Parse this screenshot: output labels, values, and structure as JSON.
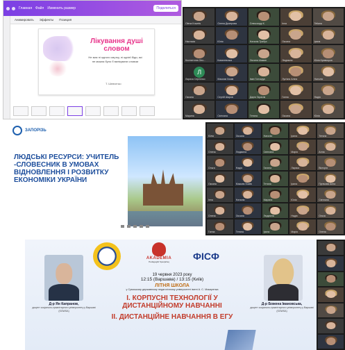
{
  "canva": {
    "menu": [
      "Главная",
      "Файл",
      "Изменить размер"
    ],
    "share": "Поделиться",
    "toolbar": [
      "Анимировать",
      "Эффекты",
      "Позиция"
    ],
    "slide_title": "Лікування душі словом",
    "slide_body": "Не має ні одного смутку, ні однієї біди, які не можна було б вилікувати словом",
    "slide_sign": "Т. Шевченко"
  },
  "grid1": [
    {
      "name": "Olena Kravets",
      "letter": ""
    },
    {
      "name": "Олена Дмитрова",
      "letter": ""
    },
    {
      "name": "Олександр К.",
      "letter": ""
    },
    {
      "name": "Inna",
      "letter": ""
    },
    {
      "name": "Tetiana",
      "letter": ""
    },
    {
      "name": "Настасія",
      "letter": ""
    },
    {
      "name": "Юлія",
      "letter": ""
    },
    {
      "name": "Наталія Трибух",
      "letter": ""
    },
    {
      "name": "Оксана",
      "letter": ""
    },
    {
      "name": "Ірина",
      "letter": ""
    },
    {
      "name": "Костянтина Оно...",
      "letter": ""
    },
    {
      "name": "Ковалевська",
      "letter": ""
    },
    {
      "name": "Оксана Шаман",
      "letter": ""
    },
    {
      "name": "Людмила",
      "letter": ""
    },
    {
      "name": "Юлія Кривоцька",
      "letter": ""
    },
    {
      "name": "Лариса Сергієнко",
      "letter": "Л"
    },
    {
      "name": "Максим Хомів",
      "letter": ""
    },
    {
      "name": "Іван Гончарук",
      "letter": ""
    },
    {
      "name": "Лук'яна Аліна",
      "letter": ""
    },
    {
      "name": "Наталія",
      "letter": ""
    },
    {
      "name": "Оксана",
      "letter": ""
    },
    {
      "name": "Сергій Шаров",
      "letter": ""
    },
    {
      "name": "Дарія Гарасім",
      "letter": ""
    },
    {
      "name": "Ганна",
      "letter": ""
    },
    {
      "name": "Надія",
      "letter": ""
    },
    {
      "name": "Марина",
      "letter": ""
    },
    {
      "name": "Світлана",
      "letter": ""
    },
    {
      "name": "Тетяна",
      "letter": ""
    },
    {
      "name": "Оксана",
      "letter": ""
    },
    {
      "name": "Юлія",
      "letter": ""
    }
  ],
  "slide2": {
    "logo": "ЗАПОРІЗЬ",
    "text": "ЛЮДСЬКІ РЕСУРСИ: УЧИТЕЛЬ -СЛОВЕСНИК В УМОВАХ ВІДНОВЛЕННЯ І РОЗВИТКУ ЕКОНОМІКИ УКРАЇНИ"
  },
  "grid2": [
    {
      "name": "Юлія",
      "letter": ""
    },
    {
      "name": "Оксана",
      "letter": ""
    },
    {
      "name": "Наталія",
      "letter": ""
    },
    {
      "name": "Ірина",
      "letter": ""
    },
    {
      "name": "Тетяна",
      "letter": ""
    },
    {
      "name": "Олена",
      "letter": ""
    },
    {
      "name": "Людмила",
      "letter": ""
    },
    {
      "name": "Світлана",
      "letter": ""
    },
    {
      "name": "Марія",
      "letter": ""
    },
    {
      "name": "Алла",
      "letter": ""
    },
    {
      "name": "Ольга",
      "letter": ""
    },
    {
      "name": "Надія",
      "letter": ""
    },
    {
      "name": "Галина",
      "letter": ""
    },
    {
      "name": "Лариса",
      "letter": ""
    },
    {
      "name": "Вікторія",
      "letter": ""
    },
    {
      "name": "Оксана",
      "letter": ""
    },
    {
      "name": "Максим Хомів",
      "letter": ""
    },
    {
      "name": "Тетяна",
      "letter": ""
    },
    {
      "name": "Ірина",
      "letter": ""
    },
    {
      "name": "Пугачова Анна",
      "letter": ""
    },
    {
      "name": "Інна",
      "letter": ""
    },
    {
      "name": "Наталія",
      "letter": ""
    },
    {
      "name": "Марина",
      "letter": ""
    },
    {
      "name": "Юлія",
      "letter": ""
    },
    {
      "name": "Світлана",
      "letter": ""
    },
    {
      "name": "Олена",
      "letter": ""
    },
    {
      "name": "Оксана",
      "letter": ""
    },
    {
      "name": "Людмила",
      "letter": ""
    },
    {
      "name": "Надія",
      "letter": ""
    },
    {
      "name": "Ольга",
      "letter": ""
    },
    {
      "name": "Ганна",
      "letter": ""
    },
    {
      "name": "Тетяна",
      "letter": ""
    },
    {
      "name": "Ірина",
      "letter": ""
    },
    {
      "name": "Марія",
      "letter": ""
    },
    {
      "name": "Олена",
      "letter": ""
    }
  ],
  "poster": {
    "logo2_title": "AKADEMIA",
    "logo2_sub": "Pedagogiki Specjalnej",
    "logo3": "ФІСФ",
    "date": "19 червня 2023 року",
    "time": "12:15 (Варшава) / 13:15 (Київ)",
    "event": "ЛІТНЯ ШКОЛА",
    "host": "у Сумському державному педагогічному університеті імені А. С. Макаренка",
    "speaker_left": "Д-р Ян Капранов,",
    "speaker_left_role": "доцент соціально-гуманітарного університету у Варшаві (SGWSA)",
    "speaker_right": "Д-р Божена Івановська,",
    "speaker_right_role": "доцент соціально-гуманітарного університету у Варшаві (SGWSA)",
    "topic1": "І. КОРПУСНІ ТЕХНОЛОГІЇ У ДИСТАНЦІЙНОМУ НАВЧАННІ",
    "topic2": "ІІ. ДИСТАНЦІЙНЕ НАВЧАННЯ В ЕГУ"
  },
  "grid3": [
    {
      "name": "",
      "letter": ""
    },
    {
      "name": "",
      "letter": ""
    },
    {
      "name": "",
      "letter": ""
    },
    {
      "name": "",
      "letter": ""
    },
    {
      "name": "",
      "letter": ""
    },
    {
      "name": "",
      "letter": ""
    },
    {
      "name": "",
      "letter": ""
    }
  ],
  "colors": {
    "canva": "#7b3fe4",
    "accent_pink": "#e8358b",
    "slide2_blue": "#1d4e9c",
    "poster_red": "#c23b2a"
  }
}
